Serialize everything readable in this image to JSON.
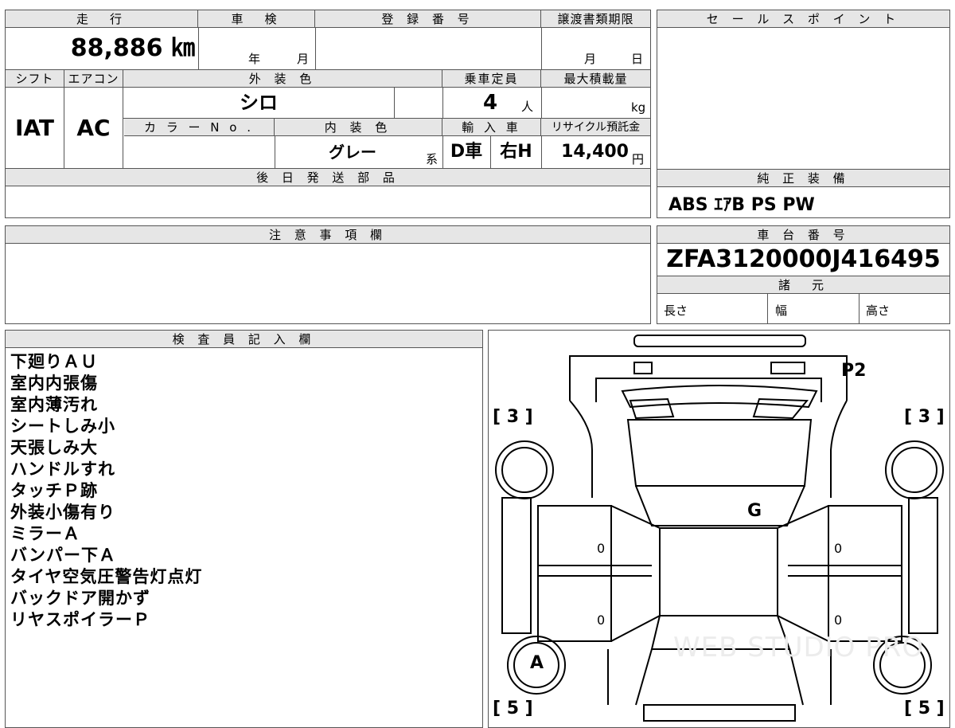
{
  "top_table": {
    "mileage_label": "走　行",
    "mileage_value": "88,886 ㎞",
    "inspection_label": "車　検",
    "inspection_year_unit": "年",
    "inspection_month_unit": "月",
    "registration_label": "登 録 番 号",
    "registration_value": "",
    "transfer_deadline_label": "譲渡書類期限",
    "transfer_month_unit": "月",
    "transfer_day_unit": "日",
    "shift_label": "シフト",
    "shift_value": "IAT",
    "aircon_label": "エアコン",
    "aircon_value": "AC",
    "exterior_color_label": "外 装 色",
    "exterior_color_value": "シロ",
    "capacity_label": "乗車定員",
    "capacity_value": "4",
    "capacity_unit": "人",
    "max_load_label": "最大積載量",
    "max_load_unit": "kg",
    "color_no_label": "カ ラ ー N o .",
    "interior_color_label": "内 装 色",
    "interior_color_value": "グレー",
    "interior_color_suffix": "系",
    "import_label": "輸 入 車",
    "import_value_d": "D車",
    "import_value_h": "右H",
    "recycle_label": "リサイクル預託金",
    "recycle_value": "14,400",
    "recycle_unit": "円",
    "later_parts_label": "後 日 発 送 部 品"
  },
  "sales_point": {
    "label": "セ ー ル ス ポ イ ン ト"
  },
  "genuine_equipment": {
    "label": "純 正 装 備",
    "value": "ABS ｴｱB PS PW"
  },
  "caution": {
    "label": "注 意 事 項 欄"
  },
  "chassis": {
    "label": "車 台 番 号",
    "value": "ZFA3120000J416495",
    "specs_label": "諸　元",
    "length_label": "長さ",
    "width_label": "幅",
    "height_label": "高さ"
  },
  "inspector": {
    "label": "検 査 員 記 入 欄",
    "remarks": [
      "下廻りＡＵ",
      "室内内張傷",
      "室内薄汚れ",
      "シートしみ小",
      "天張しみ大",
      "ハンドルすれ",
      "タッチＰ跡",
      "外装小傷有り",
      "ミラーＡ",
      "バンパー下Ａ",
      "タイヤ空気圧警告灯点灯",
      "バックドア開かず",
      "リヤスポイラーＰ"
    ]
  },
  "diagram": {
    "mark_p2": "P2",
    "mark_g": "G",
    "mark_a": "A",
    "tread_front_left": "[ 3 ]",
    "tread_front_right": "[ 3 ]",
    "tread_rear_left": "[ 5 ]",
    "tread_rear_right": "[ 5 ]",
    "door_marks": [
      "0",
      "0",
      "0",
      "0"
    ],
    "watermark": "WEB STUDIO PRO"
  }
}
